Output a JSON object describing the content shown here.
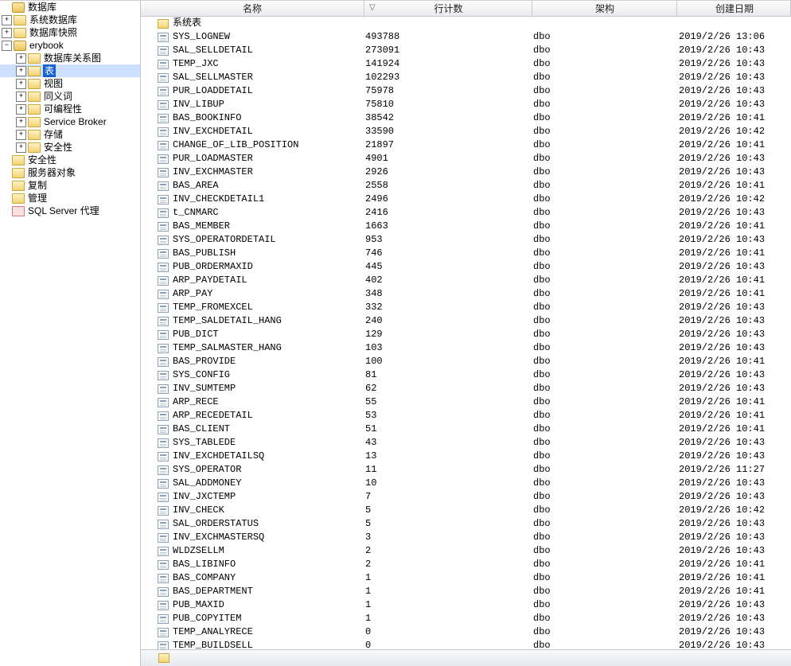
{
  "tree": {
    "nodes": [
      {
        "depth": 0,
        "exp": "blank",
        "icon": "db",
        "label": "数据库",
        "selected": false
      },
      {
        "depth": 0,
        "exp": "plus",
        "icon": "folder",
        "label": "系统数据库",
        "selected": false
      },
      {
        "depth": 0,
        "exp": "plus",
        "icon": "folder",
        "label": "数据库快照",
        "selected": false
      },
      {
        "depth": 0,
        "exp": "minus",
        "icon": "db",
        "label": "erybook",
        "selected": false
      },
      {
        "depth": 1,
        "exp": "plus",
        "icon": "folder",
        "label": "数据库关系图",
        "selected": false
      },
      {
        "depth": 1,
        "exp": "plus",
        "icon": "folder",
        "label": "表",
        "selected": true
      },
      {
        "depth": 1,
        "exp": "plus",
        "icon": "folder",
        "label": "视图",
        "selected": false
      },
      {
        "depth": 1,
        "exp": "plus",
        "icon": "folder",
        "label": "同义词",
        "selected": false
      },
      {
        "depth": 1,
        "exp": "plus",
        "icon": "folder",
        "label": "可编程性",
        "selected": false
      },
      {
        "depth": 1,
        "exp": "plus",
        "icon": "folder",
        "label": "Service Broker",
        "selected": false
      },
      {
        "depth": 1,
        "exp": "plus",
        "icon": "folder",
        "label": "存储",
        "selected": false
      },
      {
        "depth": 1,
        "exp": "plus",
        "icon": "folder",
        "label": "安全性",
        "selected": false
      },
      {
        "depth": 0,
        "exp": "blank",
        "icon": "folder",
        "label": "安全性",
        "selected": false
      },
      {
        "depth": 0,
        "exp": "blank",
        "icon": "folder",
        "label": "服务器对象",
        "selected": false
      },
      {
        "depth": 0,
        "exp": "blank",
        "icon": "folder",
        "label": "复制",
        "selected": false
      },
      {
        "depth": 0,
        "exp": "blank",
        "icon": "folder",
        "label": "管理",
        "selected": false
      },
      {
        "depth": 0,
        "exp": "blank",
        "icon": "agent",
        "label": "SQL Server 代理",
        "selected": false
      }
    ]
  },
  "grid": {
    "headers": {
      "name": "名称",
      "rows": "行计数",
      "schema": "架构",
      "date": "创建日期"
    },
    "system_folder": "系统表",
    "rows": [
      {
        "name": "SYS_LOGNEW",
        "rows": "493788",
        "schema": "dbo",
        "date": "2019/2/26 13:06"
      },
      {
        "name": "SAL_SELLDETAIL",
        "rows": "273091",
        "schema": "dbo",
        "date": "2019/2/26 10:43"
      },
      {
        "name": "TEMP_JXC",
        "rows": "141924",
        "schema": "dbo",
        "date": "2019/2/26 10:43"
      },
      {
        "name": "SAL_SELLMASTER",
        "rows": "102293",
        "schema": "dbo",
        "date": "2019/2/26 10:43"
      },
      {
        "name": "PUR_LOADDETAIL",
        "rows": "75978",
        "schema": "dbo",
        "date": "2019/2/26 10:43"
      },
      {
        "name": "INV_LIBUP",
        "rows": "75810",
        "schema": "dbo",
        "date": "2019/2/26 10:43"
      },
      {
        "name": "BAS_BOOKINFO",
        "rows": "38542",
        "schema": "dbo",
        "date": "2019/2/26 10:41"
      },
      {
        "name": "INV_EXCHDETAIL",
        "rows": "33590",
        "schema": "dbo",
        "date": "2019/2/26 10:42"
      },
      {
        "name": "CHANGE_OF_LIB_POSITION",
        "rows": "21897",
        "schema": "dbo",
        "date": "2019/2/26 10:41"
      },
      {
        "name": "PUR_LOADMASTER",
        "rows": "4901",
        "schema": "dbo",
        "date": "2019/2/26 10:43"
      },
      {
        "name": "INV_EXCHMASTER",
        "rows": "2926",
        "schema": "dbo",
        "date": "2019/2/26 10:43"
      },
      {
        "name": "BAS_AREA",
        "rows": "2558",
        "schema": "dbo",
        "date": "2019/2/26 10:41"
      },
      {
        "name": "INV_CHECKDETAIL1",
        "rows": "2496",
        "schema": "dbo",
        "date": "2019/2/26 10:42"
      },
      {
        "name": "t_CNMARC",
        "rows": "2416",
        "schema": "dbo",
        "date": "2019/2/26 10:43"
      },
      {
        "name": "BAS_MEMBER",
        "rows": "1663",
        "schema": "dbo",
        "date": "2019/2/26 10:41"
      },
      {
        "name": "SYS_OPERATORDETAIL",
        "rows": "953",
        "schema": "dbo",
        "date": "2019/2/26 10:43"
      },
      {
        "name": "BAS_PUBLISH",
        "rows": "746",
        "schema": "dbo",
        "date": "2019/2/26 10:41"
      },
      {
        "name": "PUB_ORDERMAXID",
        "rows": "445",
        "schema": "dbo",
        "date": "2019/2/26 10:43"
      },
      {
        "name": "ARP_PAYDETAIL",
        "rows": "402",
        "schema": "dbo",
        "date": "2019/2/26 10:41"
      },
      {
        "name": "ARP_PAY",
        "rows": "348",
        "schema": "dbo",
        "date": "2019/2/26 10:41"
      },
      {
        "name": "TEMP_FROMEXCEL",
        "rows": "332",
        "schema": "dbo",
        "date": "2019/2/26 10:43"
      },
      {
        "name": "TEMP_SALDETAIL_HANG",
        "rows": "240",
        "schema": "dbo",
        "date": "2019/2/26 10:43"
      },
      {
        "name": "PUB_DICT",
        "rows": "129",
        "schema": "dbo",
        "date": "2019/2/26 10:43"
      },
      {
        "name": "TEMP_SALMASTER_HANG",
        "rows": "103",
        "schema": "dbo",
        "date": "2019/2/26 10:43"
      },
      {
        "name": "BAS_PROVIDE",
        "rows": "100",
        "schema": "dbo",
        "date": "2019/2/26 10:41"
      },
      {
        "name": "SYS_CONFIG",
        "rows": "81",
        "schema": "dbo",
        "date": "2019/2/26 10:43"
      },
      {
        "name": "INV_SUMTEMP",
        "rows": "62",
        "schema": "dbo",
        "date": "2019/2/26 10:43"
      },
      {
        "name": "ARP_RECE",
        "rows": "55",
        "schema": "dbo",
        "date": "2019/2/26 10:41"
      },
      {
        "name": "ARP_RECEDETAIL",
        "rows": "53",
        "schema": "dbo",
        "date": "2019/2/26 10:41"
      },
      {
        "name": "BAS_CLIENT",
        "rows": "51",
        "schema": "dbo",
        "date": "2019/2/26 10:41"
      },
      {
        "name": "SYS_TABLEDE",
        "rows": "43",
        "schema": "dbo",
        "date": "2019/2/26 10:43"
      },
      {
        "name": "INV_EXCHDETAILSQ",
        "rows": "13",
        "schema": "dbo",
        "date": "2019/2/26 10:43"
      },
      {
        "name": "SYS_OPERATOR",
        "rows": "11",
        "schema": "dbo",
        "date": "2019/2/26 11:27"
      },
      {
        "name": "SAL_ADDMONEY",
        "rows": "10",
        "schema": "dbo",
        "date": "2019/2/26 10:43"
      },
      {
        "name": "INV_JXCTEMP",
        "rows": "7",
        "schema": "dbo",
        "date": "2019/2/26 10:43"
      },
      {
        "name": "INV_CHECK",
        "rows": "5",
        "schema": "dbo",
        "date": "2019/2/26 10:42"
      },
      {
        "name": "SAL_ORDERSTATUS",
        "rows": "5",
        "schema": "dbo",
        "date": "2019/2/26 10:43"
      },
      {
        "name": "INV_EXCHMASTERSQ",
        "rows": "3",
        "schema": "dbo",
        "date": "2019/2/26 10:43"
      },
      {
        "name": "WLDZSELLM",
        "rows": "2",
        "schema": "dbo",
        "date": "2019/2/26 10:43"
      },
      {
        "name": "BAS_LIBINFO",
        "rows": "2",
        "schema": "dbo",
        "date": "2019/2/26 10:41"
      },
      {
        "name": "BAS_COMPANY",
        "rows": "1",
        "schema": "dbo",
        "date": "2019/2/26 10:41"
      },
      {
        "name": "BAS_DEPARTMENT",
        "rows": "1",
        "schema": "dbo",
        "date": "2019/2/26 10:41"
      },
      {
        "name": "PUB_MAXID",
        "rows": "1",
        "schema": "dbo",
        "date": "2019/2/26 10:43"
      },
      {
        "name": "PUB_COPYITEM",
        "rows": "1",
        "schema": "dbo",
        "date": "2019/2/26 10:43"
      },
      {
        "name": "TEMP_ANALYRECE",
        "rows": "0",
        "schema": "dbo",
        "date": "2019/2/26 10:43"
      },
      {
        "name": "TEMP_BUILDSELL",
        "rows": "0",
        "schema": "dbo",
        "date": "2019/2/26 10:43"
      }
    ]
  },
  "status": {
    "text": ""
  }
}
